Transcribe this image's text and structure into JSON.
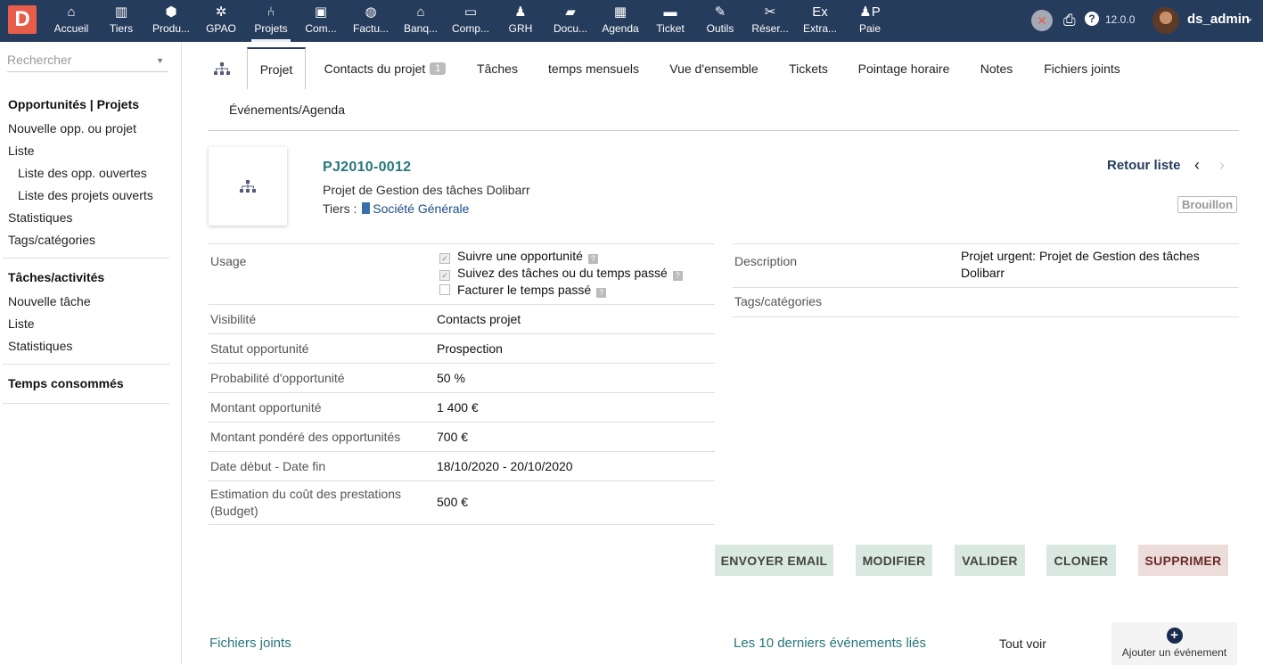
{
  "topbar": {
    "logo": "D",
    "nav": [
      {
        "label": "Accueil",
        "icon": "⌂",
        "name": "home-icon"
      },
      {
        "label": "Tiers",
        "icon": "▥",
        "name": "building-icon"
      },
      {
        "label": "Produ...",
        "icon": "⬢",
        "name": "cube-icon"
      },
      {
        "label": "GPAO",
        "icon": "✲",
        "name": "cubes-icon"
      },
      {
        "label": "Projets",
        "icon": "⑃",
        "name": "sitemap-icon"
      },
      {
        "label": "Com...",
        "icon": "▣",
        "name": "suitcase-icon"
      },
      {
        "label": "Factu...",
        "icon": "◍",
        "name": "coins-icon"
      },
      {
        "label": "Banq...",
        "icon": "⌂",
        "name": "bank-icon"
      },
      {
        "label": "Comp...",
        "icon": "▭",
        "name": "money-bill-icon"
      },
      {
        "label": "GRH",
        "icon": "♟",
        "name": "user-tie-icon"
      },
      {
        "label": "Docu...",
        "icon": "▰",
        "name": "folder-icon"
      },
      {
        "label": "Agenda",
        "icon": "▦",
        "name": "calendar-icon"
      },
      {
        "label": "Ticket",
        "icon": "▬",
        "name": "ticket-icon"
      },
      {
        "label": "Outils",
        "icon": "✎",
        "name": "wrench-icon"
      },
      {
        "label": "Réser...",
        "icon": "✂",
        "name": "tools-icon"
      },
      {
        "label": "Extra...",
        "icon": "Ex",
        "name": "ex-icon"
      },
      {
        "label": "Paie",
        "icon": "♟P",
        "name": "user-pay-icon"
      }
    ],
    "active_index": 4,
    "version": "12.0.0",
    "username": "ds_admin"
  },
  "sidebar": {
    "search_placeholder": "Rechercher",
    "sections": {
      "projects_title": "Opportunités | Projets",
      "new_project": "Nouvelle opp. ou projet",
      "list": "Liste",
      "open_opps": "Liste des opp. ouvertes",
      "open_projects": "Liste des projets ouverts",
      "stats": "Statistiques",
      "tags": "Tags/catégories",
      "tasks_title": "Tâches/activités",
      "new_task": "Nouvelle tâche",
      "task_list": "Liste",
      "task_stats": "Statistiques",
      "time_title": "Temps consommés"
    }
  },
  "tabs": {
    "project": "Projet",
    "contacts": "Contacts du projet",
    "contacts_count": "1",
    "tasks": "Tâches",
    "monthly": "temps mensuels",
    "overview": "Vue d'ensemble",
    "tickets": "Tickets",
    "timesheet": "Pointage horaire",
    "notes": "Notes",
    "files": "Fichiers joints",
    "events": "Événements/Agenda"
  },
  "project": {
    "ref": "PJ2010-0012",
    "title": "Projet de Gestion des tâches Dolibarr",
    "tiers_label": "Tiers :",
    "tiers_name": "Société Générale",
    "back": "Retour liste",
    "prev": "‹",
    "next": "›",
    "status": "Brouillon"
  },
  "fields": {
    "usage_label": "Usage",
    "usage_opts": [
      {
        "label": "Suivre une opportunité",
        "checked": true
      },
      {
        "label": "Suivez des tâches ou du temps passé",
        "checked": true
      },
      {
        "label": "Facturer le temps passé",
        "checked": false
      }
    ],
    "visibility_label": "Visibilité",
    "visibility": "Contacts projet",
    "opp_status_label": "Statut opportunité",
    "opp_status": "Prospection",
    "opp_prob_label": "Probabilité d'opportunité",
    "opp_prob": "50 %",
    "opp_amount_label": "Montant opportunité",
    "opp_amount": "1 400 €",
    "opp_weighted_label": "Montant pondéré des opportunités",
    "opp_weighted": "700 €",
    "dates_label": "Date début - Date fin",
    "dates": "18/10/2020 - 20/10/2020",
    "budget_label_1": "Estimation du coût des prestations",
    "budget_label_2": "(Budget)",
    "budget": "500 €",
    "desc_label": "Description",
    "desc_1": "Projet urgent: Projet de Gestion des tâches",
    "desc_2": "Dolibarr",
    "tags_label": "Tags/catégories"
  },
  "actions": {
    "email": "ENVOYER EMAIL",
    "modify": "MODIFIER",
    "validate": "VALIDER",
    "clone": "CLONER",
    "delete": "SUPPRIMER"
  },
  "bottom": {
    "files": "Fichiers joints",
    "last_events": "Les 10 derniers événements liés",
    "see_all": "Tout voir",
    "add_event": "Ajouter un événement"
  },
  "colors": {
    "topbar": "#263c5c",
    "logo": "#e85d4a",
    "link_teal": "#25767a",
    "button_green": "#d9e8e0",
    "button_red": "#ecddda"
  }
}
